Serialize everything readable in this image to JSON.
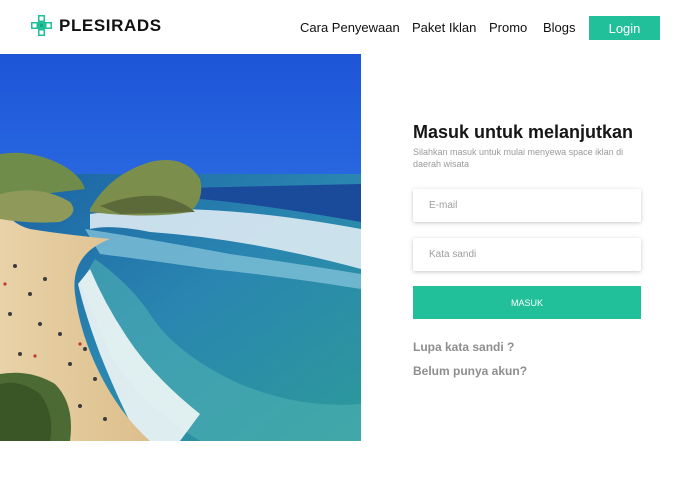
{
  "brand": {
    "name": "PLESIRADS",
    "logo_icon": "plus-cross-icon",
    "color": "#21bf9a"
  },
  "nav": {
    "items": [
      "Cara Penyewaan",
      "Paket Iklan",
      "Promo",
      "Blogs"
    ],
    "login_label": "Login"
  },
  "hero": {
    "image": "beach-coast-photo"
  },
  "form": {
    "title": "Masuk untuk melanjutkan",
    "subtitle": "Silahkan masuk untuk mulai menyewa space iklan di daerah wisata",
    "email_placeholder": "E-mail",
    "password_placeholder": "Kata sandi",
    "submit_label": "MASUK",
    "forgot_label": "Lupa kata sandi ?",
    "register_label": "Belum punya akun?"
  },
  "colors": {
    "accent": "#21bf9a",
    "text": "#161616",
    "muted": "#8e8e8e"
  }
}
